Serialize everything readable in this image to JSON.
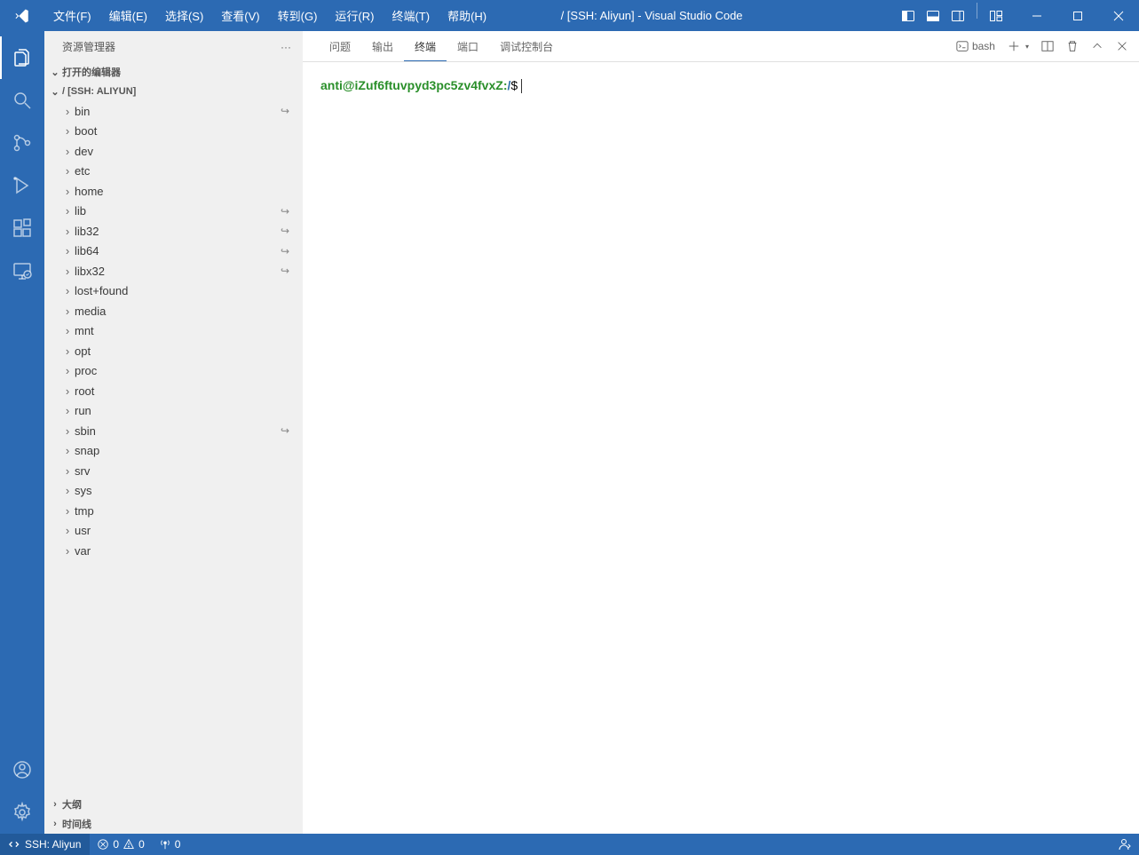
{
  "title": "/ [SSH: Aliyun] - Visual Studio Code",
  "menu": [
    "文件(F)",
    "编辑(E)",
    "选择(S)",
    "查看(V)",
    "转到(G)",
    "运行(R)",
    "终端(T)",
    "帮助(H)"
  ],
  "sidebar": {
    "title": "资源管理器",
    "sections": {
      "open_editors": "打开的编辑器",
      "root": "/ [SSH: ALIYUN]",
      "outline": "大纲",
      "timeline": "时间线"
    },
    "folders": [
      {
        "name": "bin",
        "link": true
      },
      {
        "name": "boot",
        "link": false
      },
      {
        "name": "dev",
        "link": false
      },
      {
        "name": "etc",
        "link": false
      },
      {
        "name": "home",
        "link": false
      },
      {
        "name": "lib",
        "link": true
      },
      {
        "name": "lib32",
        "link": true
      },
      {
        "name": "lib64",
        "link": true
      },
      {
        "name": "libx32",
        "link": true
      },
      {
        "name": "lost+found",
        "link": false
      },
      {
        "name": "media",
        "link": false
      },
      {
        "name": "mnt",
        "link": false
      },
      {
        "name": "opt",
        "link": false
      },
      {
        "name": "proc",
        "link": false
      },
      {
        "name": "root",
        "link": false
      },
      {
        "name": "run",
        "link": false
      },
      {
        "name": "sbin",
        "link": true
      },
      {
        "name": "snap",
        "link": false
      },
      {
        "name": "srv",
        "link": false
      },
      {
        "name": "sys",
        "link": false
      },
      {
        "name": "tmp",
        "link": false
      },
      {
        "name": "usr",
        "link": false
      },
      {
        "name": "var",
        "link": false
      }
    ]
  },
  "panel": {
    "tabs": [
      "问题",
      "输出",
      "终端",
      "端口",
      "调试控制台"
    ],
    "active": 2,
    "shell": "bash"
  },
  "terminal": {
    "user_host": "anti@iZuf6ftuvpyd3pc5zv4fvxZ",
    "path": "/",
    "symbol": "$"
  },
  "status": {
    "remote": "SSH: Aliyun",
    "errors": "0",
    "warnings": "0",
    "ports": "0"
  }
}
